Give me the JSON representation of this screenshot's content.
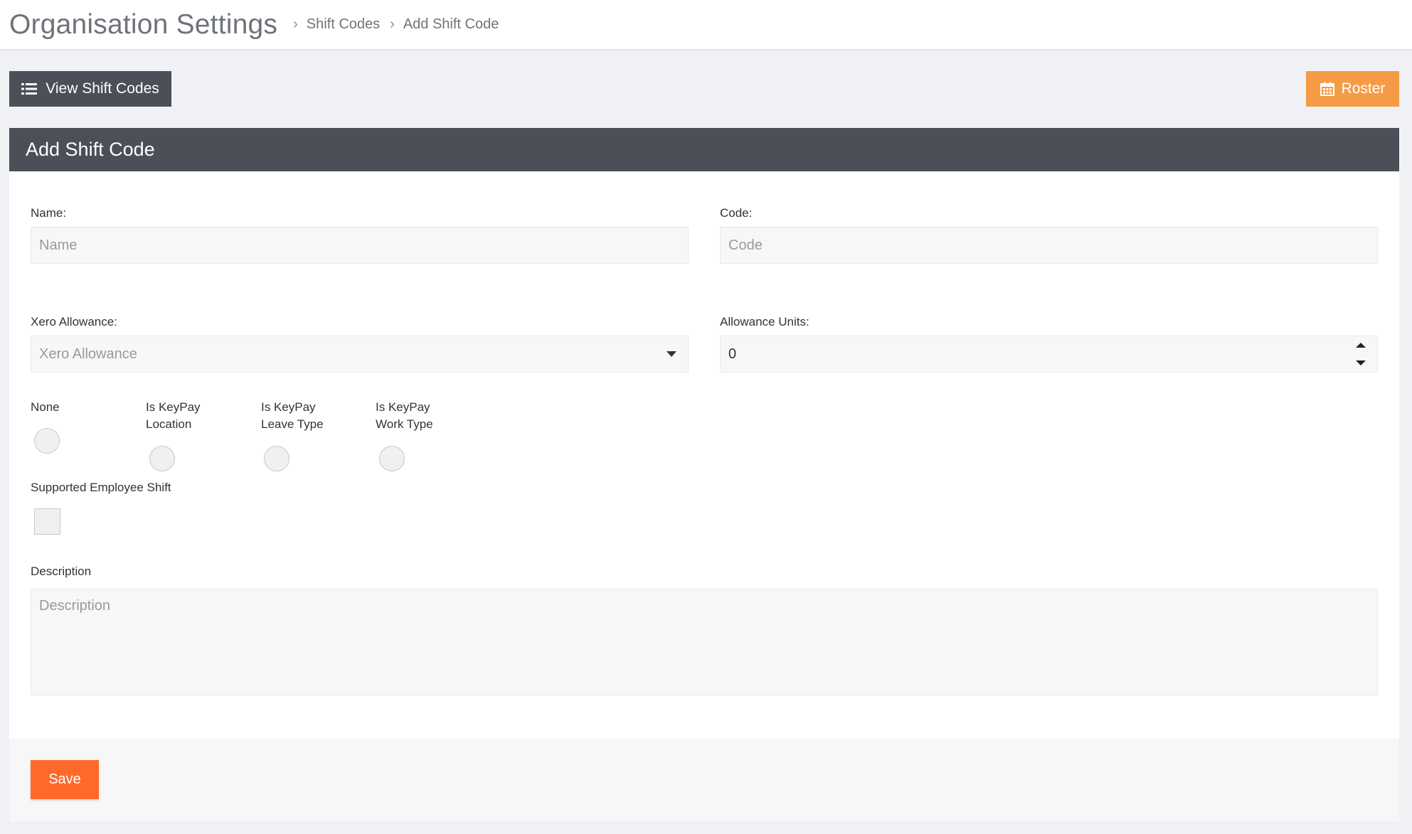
{
  "header": {
    "title": "Organisation Settings",
    "breadcrumb": [
      "Shift Codes",
      "Add Shift Code"
    ]
  },
  "toolbar": {
    "view_label": "View Shift Codes",
    "view_icon": "list-icon",
    "roster_label": "Roster",
    "roster_icon": "calendar-icon",
    "roster_color": "#f59b45",
    "view_color": "#4a4f58"
  },
  "panel": {
    "title": "Add Shift Code"
  },
  "form": {
    "name": {
      "label": "Name:",
      "placeholder": "Name",
      "value": ""
    },
    "code": {
      "label": "Code:",
      "placeholder": "Code",
      "value": ""
    },
    "xero_allowance": {
      "label": "Xero Allowance:",
      "placeholder": "Xero Allowance",
      "value": ""
    },
    "allowance_units": {
      "label": "Allowance Units:",
      "value": "0"
    },
    "radios": [
      {
        "label": "None",
        "checked": false
      },
      {
        "label": "Is KeyPay Location",
        "checked": false
      },
      {
        "label": "Is KeyPay Leave Type",
        "checked": false
      },
      {
        "label": "Is KeyPay Work Type",
        "checked": false
      }
    ],
    "supported_employee_shift": {
      "label": "Supported Employee Shift",
      "checked": false
    },
    "description": {
      "label": "Description",
      "placeholder": "Description",
      "value": ""
    }
  },
  "footer": {
    "save_label": "Save",
    "save_color": "#ff6a2a"
  }
}
